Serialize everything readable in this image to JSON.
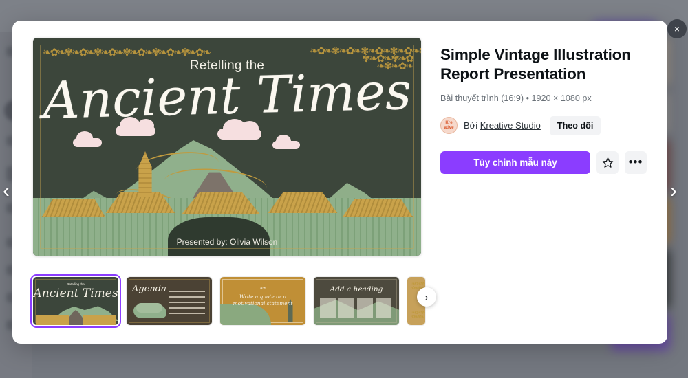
{
  "overlay": {
    "close_icon": "close-icon",
    "prev_icon": "chevron-left-icon",
    "next_icon": "chevron-right-icon",
    "close_label": "×",
    "prev_label": "‹",
    "next_label": "›"
  },
  "preview": {
    "kicker": "Retelling the",
    "title": "Ancient Times",
    "credit": "Presented by: Olivia Wilson",
    "bg_color": "#3c463b",
    "accent_gold": "#c09a3e",
    "mountain_green": "#90b08c",
    "cloud_pink": "#f6dfe0"
  },
  "info": {
    "title": "Simple Vintage Illustration Report Presentation",
    "meta": "Bài thuyết trình (16:9) • 1920 × 1080 px",
    "by_prefix": "Bởi",
    "author": "Kreative Studio",
    "avatar_line1": "Kre",
    "avatar_line2": "ative",
    "follow_label": "Theo dõi",
    "primary_label": "Tùy chỉnh mẫu này",
    "star_icon": "star-outline-icon",
    "more_icon": "more-horizontal-icon",
    "more_label": "•••",
    "accent_color": "#8b3dff"
  },
  "thumbnails": {
    "next_label": "›",
    "next_icon": "chevron-right-icon",
    "items": [
      {
        "name": "thumb-title-slide",
        "label": "Ancient Times",
        "kicker": "Retelling the",
        "bg": "#3c463b",
        "selected": true
      },
      {
        "name": "thumb-agenda",
        "label": "Agenda",
        "kicker": "",
        "bg": "#4b4234",
        "selected": false
      },
      {
        "name": "thumb-quote",
        "label": "Write a quote or a motivational statement",
        "kicker": "",
        "bg": "#c08f36",
        "selected": false
      },
      {
        "name": "thumb-heading",
        "label": "Add a heading",
        "kicker": "",
        "bg": "#4d4a3e",
        "selected": false
      },
      {
        "name": "thumb-next-partial",
        "label": "",
        "kicker": "",
        "bg": "#c7a15a",
        "selected": false
      }
    ]
  }
}
